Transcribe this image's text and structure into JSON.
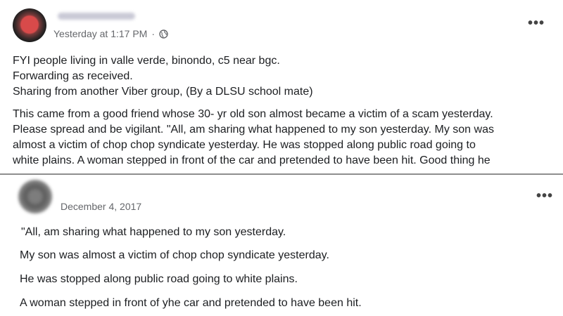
{
  "post1": {
    "author": "",
    "timestamp": "Yesterday at 1:17 PM",
    "separator": "·",
    "privacy_icon": "globe-icon",
    "more_icon": "more-options-icon",
    "more_label": "•••",
    "intro_lines": [
      "FYI people living in valle verde, binondo, c5 near bgc.",
      "Forwarding as received.",
      "Sharing from another Viber group, (By a DLSU school mate)"
    ],
    "body_lines": [
      "This came from a good friend whose 30- yr old son almost became a victim of a scam yesterday.",
      "Please spread and be vigilant. \"All, am sharing what happened to my son yesterday. My son was",
      "almost a victim of chop chop syndicate yesterday. He was stopped along public road going to",
      "white plains. A woman stepped in front of the car and pretended to have been hit. Good thing he"
    ]
  },
  "post2": {
    "timestamp": "December 4, 2017",
    "more_icon": "more-options-icon",
    "more_label": "•••",
    "lines": [
      "\"All, am sharing what happened to my son yesterday.",
      "My son was almost a victim of chop chop syndicate yesterday.",
      "He was stopped along public road going to white plains.",
      "A woman stepped in front of yhe car and pretended to have been hit."
    ]
  }
}
